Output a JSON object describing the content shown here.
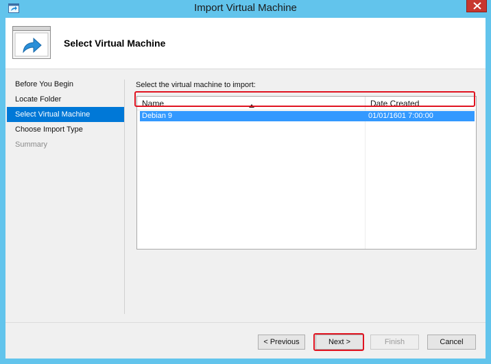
{
  "window": {
    "title": "Import Virtual Machine",
    "icon": "import-arrow-icon",
    "close_icon": "close-icon",
    "accent": "#62c4ec"
  },
  "header": {
    "title": "Select Virtual Machine",
    "icon": "import-arrow-icon"
  },
  "nav": {
    "items": [
      {
        "label": "Before You Begin",
        "state": "normal"
      },
      {
        "label": "Locate Folder",
        "state": "normal"
      },
      {
        "label": "Select Virtual Machine",
        "state": "active"
      },
      {
        "label": "Choose Import Type",
        "state": "normal"
      },
      {
        "label": "Summary",
        "state": "disabled"
      }
    ]
  },
  "main": {
    "prompt": "Select the virtual machine to import:",
    "columns": [
      "Name",
      "Date Created"
    ],
    "sort_icon": "sort-up-icon",
    "rows": [
      {
        "name": "Debian 9",
        "date_created": "01/01/1601 7:00:00",
        "selected": true
      }
    ],
    "highlight_color": "#e0121f",
    "selection_color": "#3399ff"
  },
  "buttons": {
    "previous": "< Previous",
    "next": "Next >",
    "finish": "Finish",
    "cancel": "Cancel"
  }
}
